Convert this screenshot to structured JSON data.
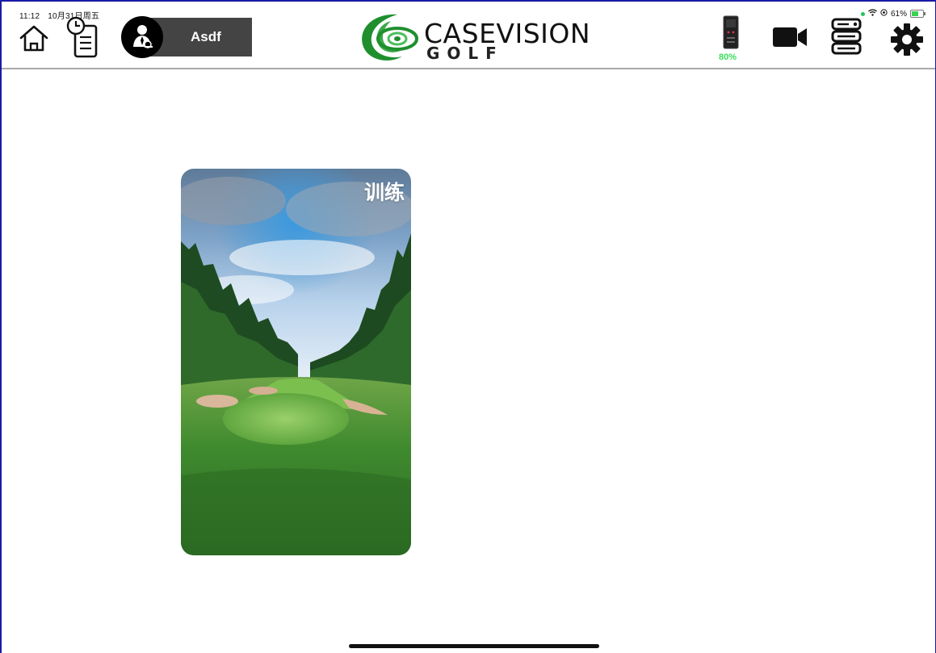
{
  "status_bar": {
    "time": "11:12",
    "date": "10月31日周五",
    "battery_percent": "61%"
  },
  "header": {
    "user_name": "Asdf",
    "logo_main": "CASEVISION",
    "logo_sub": "GOLF",
    "device_battery": "80%",
    "icons": [
      "home-icon",
      "history-icon",
      "user-icon",
      "device-icon",
      "camera-icon",
      "server-icon",
      "gear-icon"
    ],
    "accent_color": "#3adf5a",
    "logo_green": "#1f8f2e"
  },
  "main": {
    "cards": [
      {
        "title": "训练",
        "image": "golf-course-image"
      }
    ]
  }
}
